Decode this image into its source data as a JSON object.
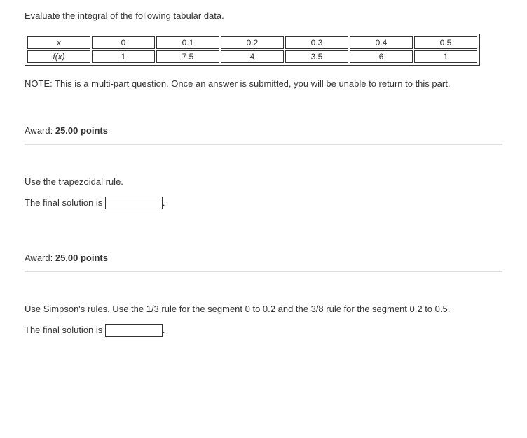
{
  "question": {
    "prompt": "Evaluate the integral of the following tabular data.",
    "table": {
      "rows": [
        {
          "label": "x",
          "values": [
            "0",
            "0.1",
            "0.2",
            "0.3",
            "0.4",
            "0.5"
          ]
        },
        {
          "label": "f(x)",
          "values": [
            "1",
            "7.5",
            "4",
            "3.5",
            "6",
            "1"
          ]
        }
      ]
    },
    "note": "NOTE: This is a multi-part question. Once an answer is submitted, you will be unable to return to this part."
  },
  "parts": [
    {
      "award_label": "Award: ",
      "award_points": "25.00 points",
      "instruction": "Use the trapezoidal rule.",
      "solution_prefix": "The final solution is ",
      "solution_suffix": "."
    },
    {
      "award_label": "Award: ",
      "award_points": "25.00 points",
      "instruction": "Use Simpson's rules. Use the 1/3 rule for the segment 0 to 0.2 and the 3/8 rule for the segment 0.2 to 0.5.",
      "solution_prefix": "The final solution is ",
      "solution_suffix": "."
    }
  ]
}
